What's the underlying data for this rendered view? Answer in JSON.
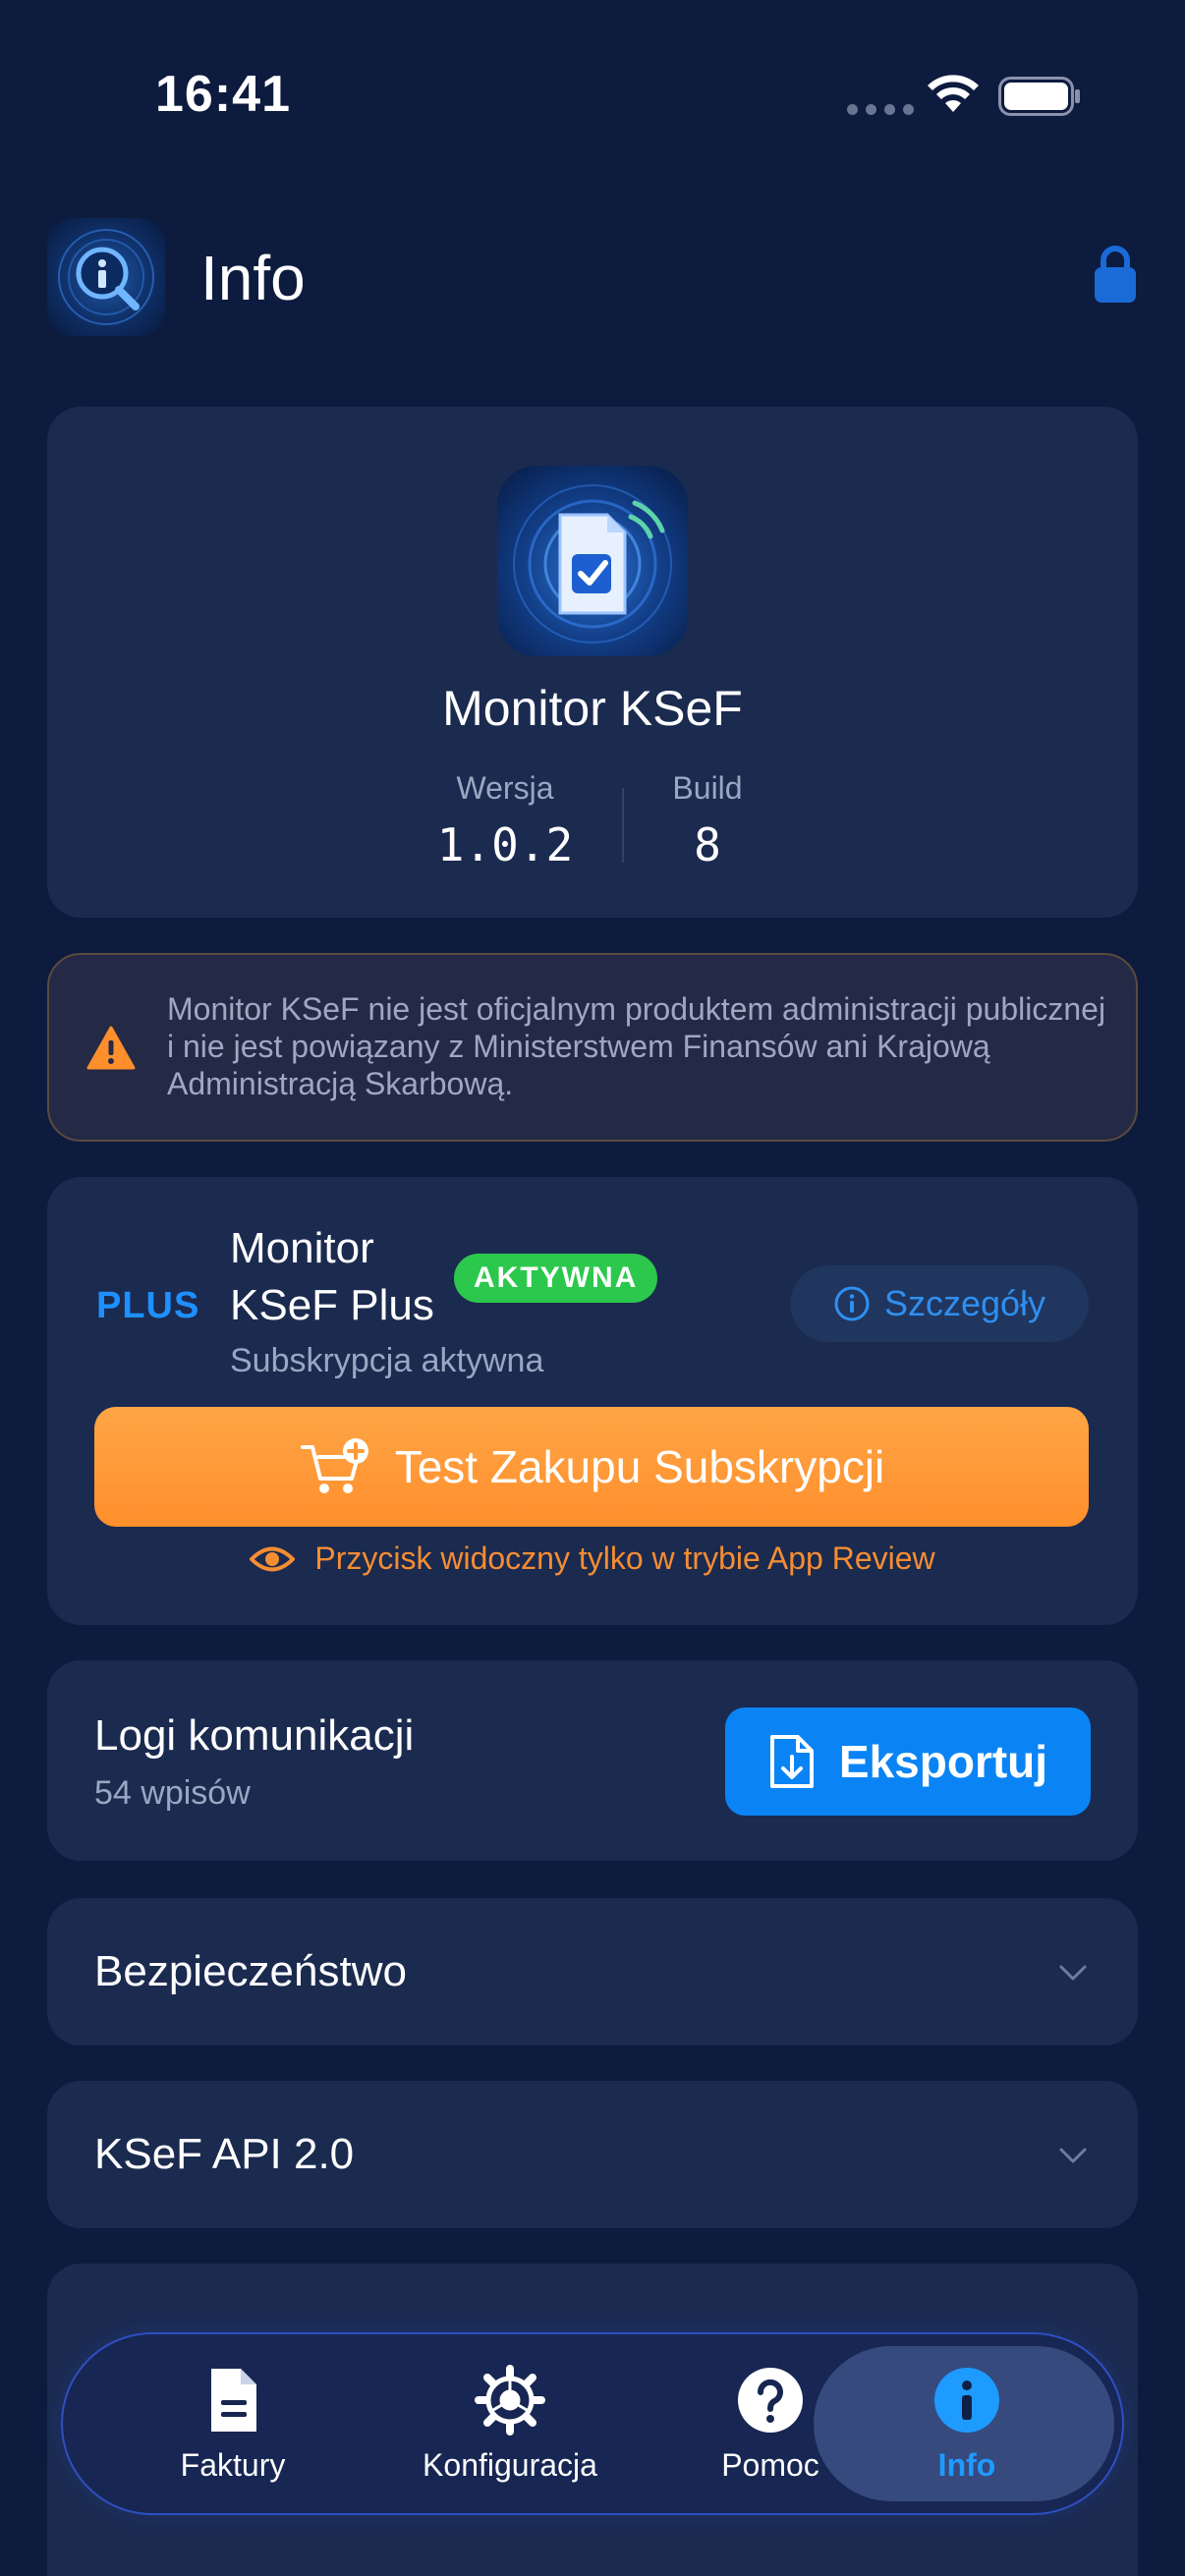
{
  "status": {
    "time": "16:41"
  },
  "header": {
    "title": "Info"
  },
  "app": {
    "name": "Monitor KSeF",
    "version_label": "Wersja",
    "version": "1.0.2",
    "build_label": "Build",
    "build": "8"
  },
  "disclaimer": {
    "text": "Monitor KSeF nie jest oficjalnym produktem administracji publicznej i nie jest powiązany z Ministerstwem Finansów ani Krajową Administracją Skarbową."
  },
  "plus": {
    "badge": "PLUS",
    "title": "Monitor KSeF Plus",
    "status_pill": "AKTYWNA",
    "subtitle": "Subskrypcja aktywna",
    "details_label": "Szczegóły",
    "buy_label": "Test Zakupu Subskrypcji",
    "review_note": "Przycisk widoczny tylko w trybie App Review"
  },
  "logs": {
    "title": "Logi komunikacji",
    "count": "54 wpisów",
    "export_label": "Eksportuj"
  },
  "sections": [
    {
      "title": "Bezpieczeństwo"
    },
    {
      "title": "KSeF API 2.0"
    }
  ],
  "tabs": [
    {
      "label": "Faktury"
    },
    {
      "label": "Konfiguracja"
    },
    {
      "label": "Pomoc"
    },
    {
      "label": "Info"
    }
  ],
  "colors": {
    "background": "#0d1b3e",
    "card": "#1b2a4f",
    "accent": "#1e90ff",
    "success": "#2cc84d",
    "warning": "#ff8f2c"
  }
}
